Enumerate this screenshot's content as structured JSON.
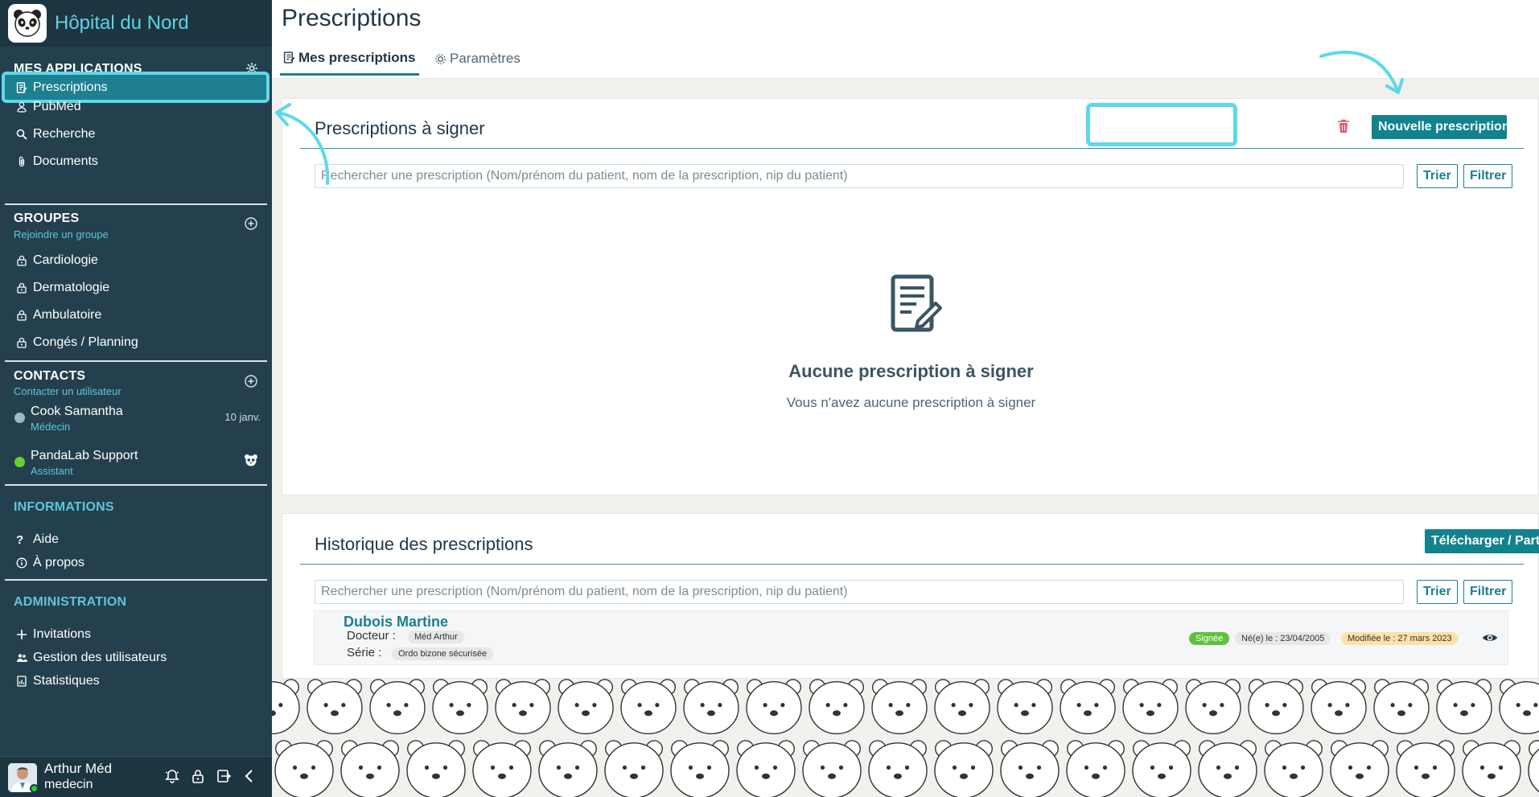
{
  "brand": {
    "name": "Hôpital du Nord",
    "logo_icon": "panda-icon"
  },
  "sidebar": {
    "apps": {
      "title": "MES APPLICATIONS",
      "items": [
        {
          "label": "Prescriptions",
          "icon": "prescription-icon",
          "active": true
        },
        {
          "label": "PubMed",
          "icon": "reader-icon"
        },
        {
          "label": "Recherche",
          "icon": "search-icon"
        },
        {
          "label": "Documents",
          "icon": "paperclip-icon"
        }
      ]
    },
    "groups": {
      "title": "GROUPES",
      "subtitle": "Rejoindre un groupe",
      "items": [
        {
          "label": "Cardiologie"
        },
        {
          "label": "Dermatologie"
        },
        {
          "label": "Ambulatoire"
        },
        {
          "label": "Congés / Planning"
        }
      ]
    },
    "contacts": {
      "title": "CONTACTS",
      "subtitle": "Contacter un utilisateur",
      "items": [
        {
          "name": "Cook Samantha",
          "role": "Médecin",
          "date": "10 janv.",
          "status_color": "#9fb8c6"
        },
        {
          "name": "PandaLab Support",
          "role": "Assistant",
          "status_color": "#63d12e"
        }
      ]
    },
    "informations": {
      "title": "INFORMATIONS",
      "items": [
        {
          "label": "Aide"
        },
        {
          "label": "À propos"
        }
      ]
    },
    "administration": {
      "title": "ADMINISTRATION",
      "items": [
        {
          "label": "Invitations"
        },
        {
          "label": "Gestion des utilisateurs"
        },
        {
          "label": "Statistiques"
        }
      ]
    },
    "user": {
      "name": "Arthur Méd",
      "role": "medecin"
    }
  },
  "main": {
    "title": "Prescriptions",
    "tabs": [
      {
        "label": "Mes prescriptions",
        "active": true
      },
      {
        "label": "Paramètres"
      }
    ],
    "to_sign": {
      "title": "Prescriptions à signer",
      "new_button": "Nouvelle prescription",
      "search_placeholder": "Rechercher une prescription (Nom/prénom du patient, nom de la prescription, nip du patient)",
      "sort": "Trier",
      "filter": "Filtrer",
      "empty_title": "Aucune prescription à signer",
      "empty_sub": "Vous n'avez aucune prescription à signer"
    },
    "history": {
      "title": "Historique des prescriptions",
      "download_button": "Télécharger / Partager",
      "search_placeholder": "Rechercher une prescription (Nom/prénom du patient, nom de la prescription, nip du patient)",
      "sort": "Trier",
      "filter": "Filtrer",
      "rows": [
        {
          "patient": "Dubois Martine",
          "doctor_label": "Docteur :",
          "doctor": "Méd Arthur",
          "series_label": "Série :",
          "series": "Ordo bizone sécurisée",
          "status": "Signée",
          "born": "Né(e) le : 23/04/2005",
          "modified": "Modifiée le : 27 mars 2023"
        }
      ]
    }
  },
  "colors": {
    "accent": "#13828f",
    "highlight": "#5cd9ea",
    "sidebar": "#24404e",
    "danger": "#e05a6a"
  }
}
